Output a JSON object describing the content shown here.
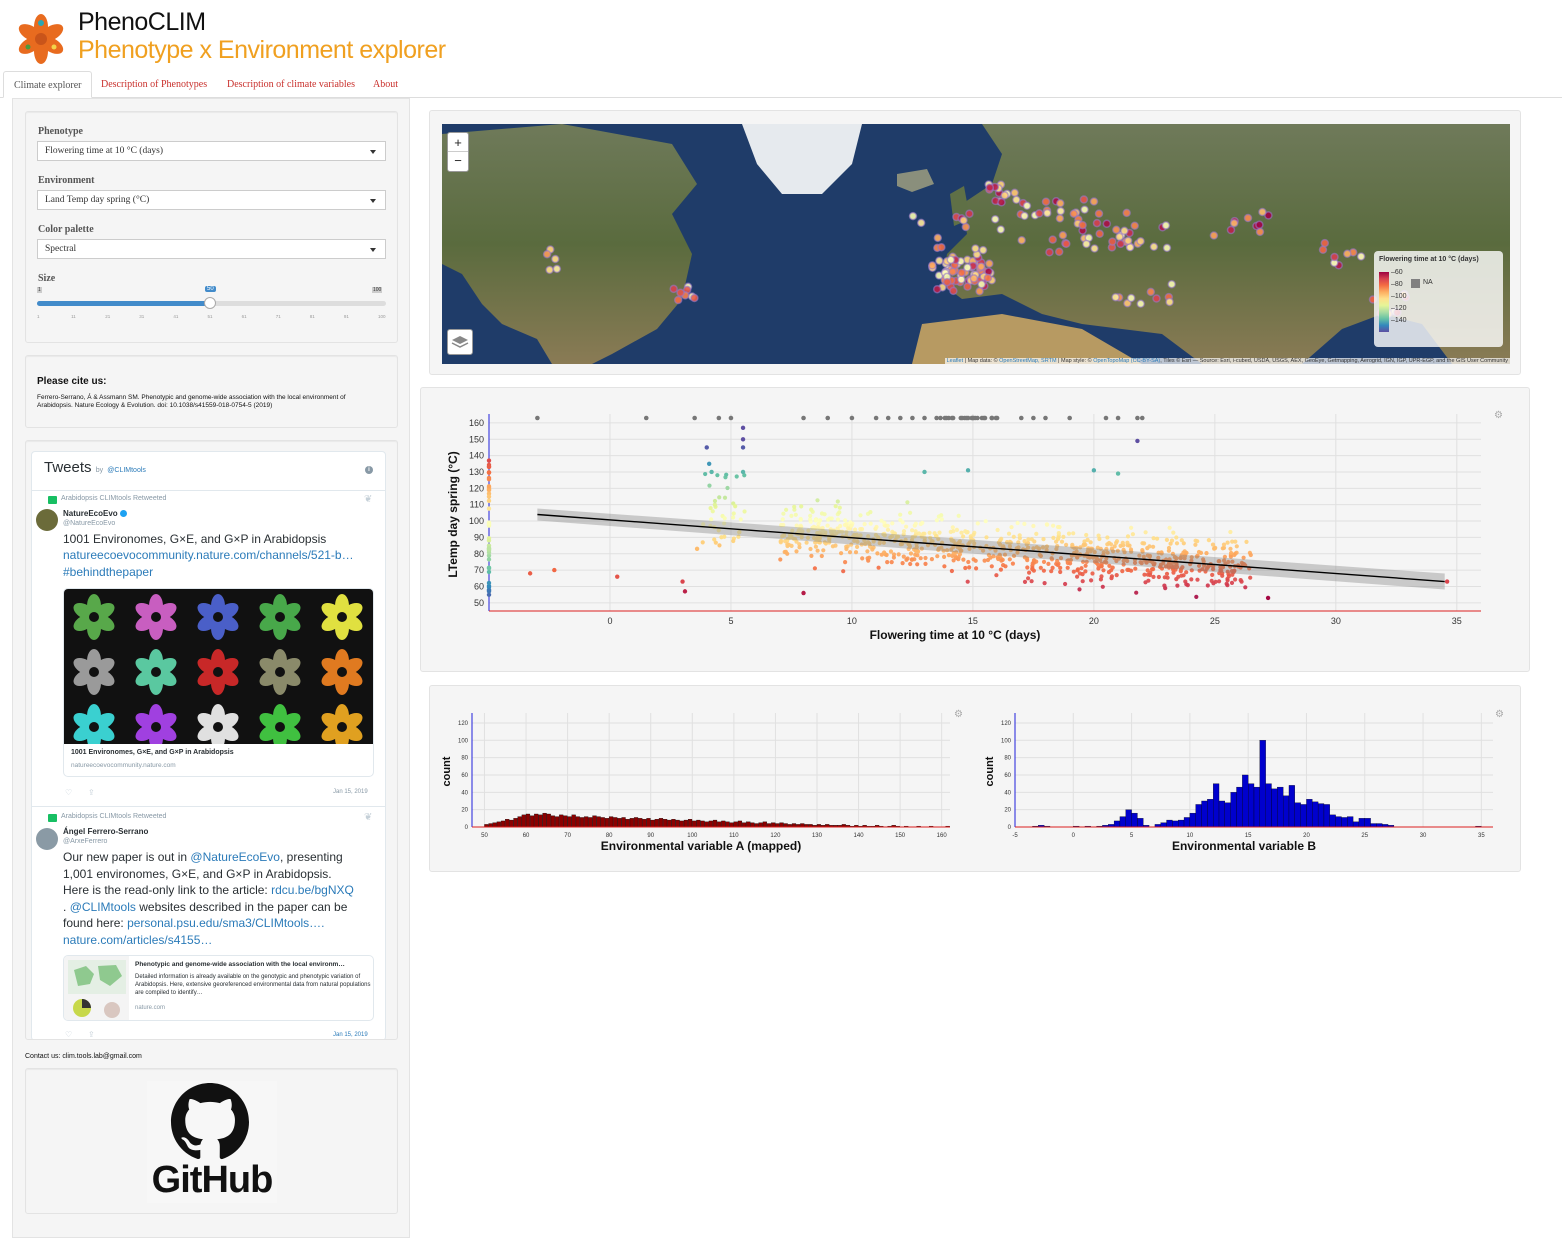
{
  "header": {
    "title": "PhenoCLIM",
    "subtitle": "Phenotype x Environment explorer"
  },
  "tabs": [
    "Climate explorer",
    "Description of Phenotypes",
    "Description of climate variables",
    "About"
  ],
  "controls": {
    "phenotype": {
      "label": "Phenotype",
      "value": "Flowering time at 10 °C (days)"
    },
    "environment": {
      "label": "Environment",
      "value": "Land Temp day spring (°C)"
    },
    "palette": {
      "label": "Color palette",
      "value": "Spectral"
    },
    "size": {
      "label": "Size",
      "min": "1",
      "max": "100",
      "value": "50",
      "ticks": [
        "1",
        "11",
        "21",
        "31",
        "41",
        "51",
        "61",
        "71",
        "81",
        "91",
        "100"
      ]
    }
  },
  "cite": {
    "title": "Please cite us:",
    "text": "Ferrero-Serrano, Á & Assmann SM. Phenotypic and genome-wide association with the local environment of Arabidopsis. Nature Ecology & Evolution. doi: 10.1038/s41559-018-0754-5 (2019)"
  },
  "tweets": {
    "header": "Tweets",
    "by": "by",
    "handle": "@CLIMtools",
    "info_glyph": "i",
    "items": [
      {
        "retweet": "Arabidopsis CLIMtools Retweeted",
        "name": "NatureEcoEvo",
        "handle": "@NatureEcoEvo",
        "text": "1001 Environomes, G×E, and G×P in Arabidopsis",
        "link1": "natureecoevocommunity.nature.com/channels/521-b…",
        "hashtag": "#behindthepaper",
        "card_title": "1001 Environomes, G×E, and G×P in Arabidopsis",
        "card_domain": "natureecoevocommunity.nature.com",
        "date": "Jan 15, 2019"
      },
      {
        "retweet": "Arabidopsis CLIMtools Retweeted",
        "name": "Ángel Ferrero-Serrano",
        "handle": "@ArxeFerrero",
        "text_a": "Our new paper is out in",
        "mention": "@NatureEcoEvo",
        "text_b": ", presenting",
        "line2": "1,001 environomes, G×E, and G×P in Arabidopsis.",
        "line3a": "Here is the read-only link to the article:",
        "link_a": "rdcu.be/bgNXQ",
        "line4a": ".",
        "mention2": "@CLIMtools",
        "line4b": "websites described in the paper can be",
        "line5a": "found here:",
        "link_b": "personal.psu.edu/sma3/CLIMtools….",
        "link_c": "nature.com/articles/s4155…",
        "card_title": "Phenotypic and genome-wide association with the local environm…",
        "card_text": "Detailed information is already available on the genotypic and phenotypic variation of Arabidopsis. Here, extensive georeferenced environmental data from natural populations are compiled to identify…",
        "card_domain": "nature.com",
        "date": "Jan 15, 2019"
      }
    ]
  },
  "contact": "Contact us: clim.tools.lab@gmail.com",
  "github": "GitHub",
  "map": {
    "zoom_in": "+",
    "zoom_out": "−",
    "legend_title": "Flowering time at 10 °C (days)",
    "legend_ticks": [
      "60",
      "80",
      "100",
      "120",
      "140"
    ],
    "legend_na": "NA",
    "attribution_a": "Leaflet",
    "attribution_b": " | Map data: © ",
    "attribution_c": "OpenStreetMap, SRTM",
    "attribution_d": " | Map style: © ",
    "attribution_e": "OpenTopoMap (CC-BY-SA)",
    "attribution_f": ", Tiles © Esri — Source: Esri, i-cubed, USDA, USGS, AEX, GeoEye, Getmapping, Aerogrid, IGN, IGP, UPR-EGP, and the GIS User Community"
  },
  "chart_data": [
    {
      "type": "scatter",
      "xlabel": "Flowering time at 10 °C (days)",
      "ylabel": "LTemp day spring (°C)",
      "xticks": [
        0,
        5,
        10,
        15,
        20,
        25,
        30,
        35
      ],
      "yticks": [
        50,
        60,
        70,
        80,
        90,
        100,
        110,
        120,
        130,
        140,
        150,
        160
      ],
      "xlim": [
        -5,
        36
      ],
      "ylim": [
        45,
        163
      ],
      "regression": {
        "x": [
          -3,
          34.5
        ],
        "y": [
          104,
          63
        ]
      },
      "na_x": [
        -3,
        1.5,
        3.5,
        4.5,
        5,
        8,
        9,
        10,
        11,
        11.5,
        12,
        12.5,
        13,
        13.5,
        14,
        14.5,
        15,
        15.5,
        16,
        17,
        17.5,
        18,
        19,
        20.5,
        21,
        21.8,
        22
      ],
      "highlight_points": [
        [
          -3.3,
          68
        ],
        [
          -2.3,
          70
        ],
        [
          0.3,
          66
        ],
        [
          3,
          63
        ],
        [
          3.1,
          57
        ],
        [
          3.6,
          83
        ],
        [
          4,
          145
        ],
        [
          4.1,
          135
        ],
        [
          4.2,
          130
        ],
        [
          5.5,
          157
        ],
        [
          5.5,
          150
        ],
        [
          5.5,
          145
        ],
        [
          5.5,
          130
        ],
        [
          8,
          56
        ],
        [
          21.8,
          149
        ],
        [
          27.2,
          53
        ],
        [
          34.6,
          63
        ],
        [
          13,
          130
        ],
        [
          14.8,
          131
        ],
        [
          20,
          131
        ],
        [
          21,
          129
        ]
      ],
      "grid": true
    },
    {
      "type": "bar",
      "title": "",
      "xlabel": "Environmental variable A (mapped)",
      "ylabel": "count",
      "xticks": [
        50,
        60,
        70,
        80,
        90,
        100,
        110,
        120,
        130,
        140,
        150,
        160
      ],
      "yticks": [
        0,
        20,
        40,
        60,
        80,
        100,
        120
      ],
      "xlim": [
        47,
        162
      ],
      "ylim": [
        0,
        128
      ],
      "bin_start": 50,
      "bin_width": 1,
      "values": [
        3,
        4,
        5,
        6,
        7,
        9,
        8,
        10,
        12,
        14,
        15,
        13,
        15,
        14,
        16,
        15,
        13,
        12,
        14,
        13,
        12,
        14,
        12,
        11,
        12,
        11,
        13,
        12,
        11,
        10,
        12,
        11,
        10,
        11,
        9,
        10,
        11,
        10,
        9,
        10,
        8,
        9,
        10,
        9,
        8,
        9,
        8,
        7,
        8,
        9,
        7,
        8,
        7,
        6,
        7,
        8,
        6,
        7,
        6,
        5,
        6,
        7,
        5,
        6,
        5,
        4,
        5,
        6,
        4,
        5,
        4,
        5,
        4,
        3,
        4,
        3,
        4,
        3,
        3,
        2,
        3,
        2,
        3,
        2,
        2,
        2,
        3,
        2,
        1,
        2,
        1,
        2,
        1,
        1,
        2,
        1,
        0,
        1,
        2,
        1,
        0,
        1,
        0,
        0,
        1,
        0,
        0,
        1,
        0,
        0,
        0,
        1
      ],
      "color": "#8b0000"
    },
    {
      "type": "bar",
      "title": "",
      "xlabel": "Environmental variable B",
      "ylabel": "count",
      "xticks": [
        -5,
        0,
        5,
        10,
        15,
        20,
        25,
        30,
        35
      ],
      "yticks": [
        0,
        20,
        40,
        60,
        80,
        100,
        120
      ],
      "xlim": [
        -5,
        36
      ],
      "ylim": [
        0,
        128
      ],
      "bins": [
        [
          -3.5,
          1
        ],
        [
          -3,
          2
        ],
        [
          -2.5,
          1
        ],
        [
          0,
          1
        ],
        [
          1,
          1
        ],
        [
          2,
          1
        ],
        [
          2.5,
          2
        ],
        [
          3,
          3
        ],
        [
          3.5,
          7
        ],
        [
          4,
          12
        ],
        [
          4.5,
          20
        ],
        [
          5,
          16
        ],
        [
          5.5,
          10
        ],
        [
          6,
          2
        ],
        [
          7,
          3
        ],
        [
          7.5,
          5
        ],
        [
          8,
          8
        ],
        [
          8.5,
          7
        ],
        [
          9,
          8
        ],
        [
          9.5,
          11
        ],
        [
          10,
          16
        ],
        [
          10.5,
          26
        ],
        [
          11,
          30
        ],
        [
          11.5,
          32
        ],
        [
          12,
          50
        ],
        [
          12.5,
          30
        ],
        [
          13,
          28
        ],
        [
          13.5,
          40
        ],
        [
          14,
          46
        ],
        [
          14.5,
          60
        ],
        [
          15,
          50
        ],
        [
          15.5,
          46
        ],
        [
          16,
          100
        ],
        [
          16.5,
          50
        ],
        [
          17,
          44
        ],
        [
          17.5,
          46
        ],
        [
          18,
          36
        ],
        [
          18.5,
          48
        ],
        [
          19,
          28
        ],
        [
          19.5,
          26
        ],
        [
          20,
          32
        ],
        [
          20.5,
          29
        ],
        [
          21,
          27
        ],
        [
          21.5,
          26
        ],
        [
          22,
          14
        ],
        [
          22.5,
          12
        ],
        [
          23,
          11
        ],
        [
          23.5,
          12
        ],
        [
          24,
          6
        ],
        [
          24.5,
          10
        ],
        [
          25,
          10
        ],
        [
          25.5,
          4
        ],
        [
          26,
          4
        ],
        [
          26.5,
          3
        ],
        [
          27,
          2
        ],
        [
          34.5,
          1
        ]
      ],
      "color": "#0000cd"
    }
  ]
}
